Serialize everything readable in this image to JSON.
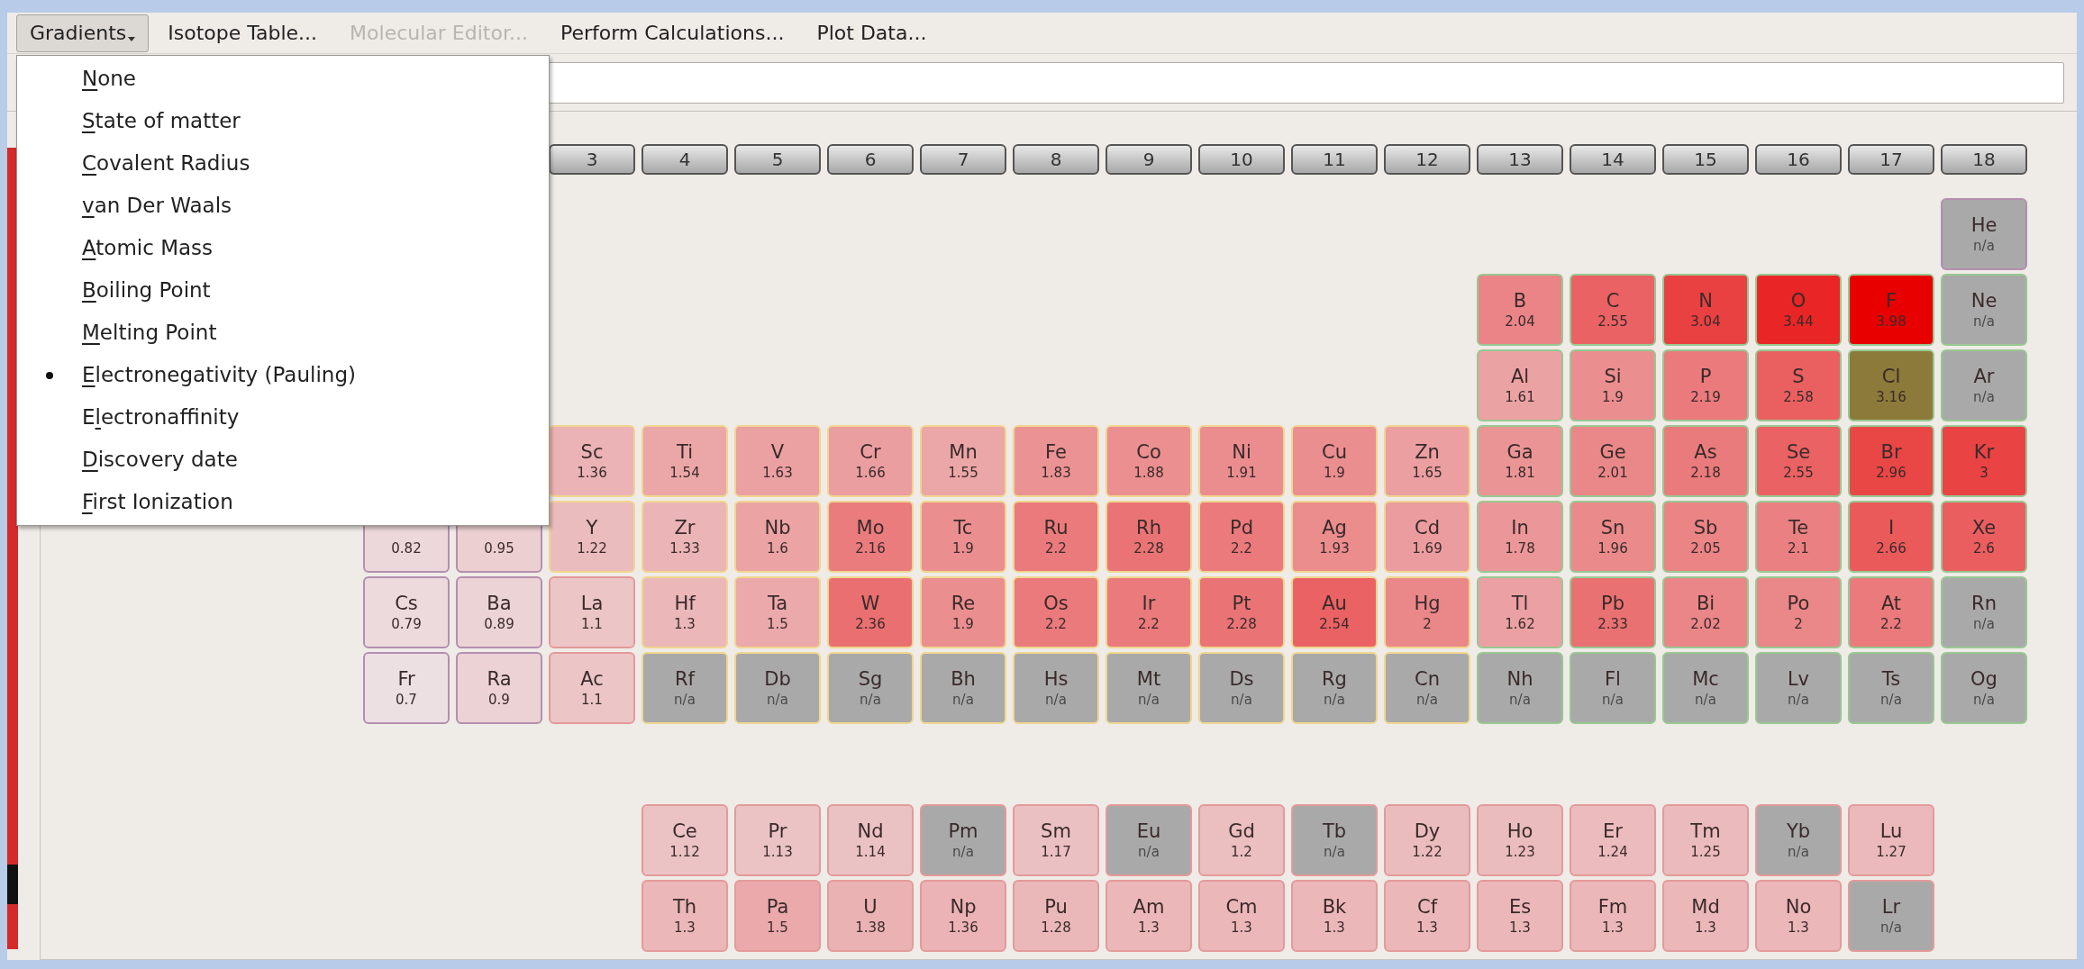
{
  "menubar": [
    {
      "label": "Gradients",
      "open": true,
      "disabled": false
    },
    {
      "label": "Isotope Table...",
      "open": false,
      "disabled": false
    },
    {
      "label": "Molecular Editor...",
      "open": false,
      "disabled": true
    },
    {
      "label": "Perform Calculations...",
      "open": false,
      "disabled": false
    },
    {
      "label": "Plot Data...",
      "open": false,
      "disabled": false
    }
  ],
  "gradients_menu": [
    {
      "key": "N",
      "post": "one",
      "selected": false
    },
    {
      "key": "S",
      "post": "tate of matter",
      "selected": false
    },
    {
      "key": "C",
      "post": "ovalent Radius",
      "selected": false
    },
    {
      "key": "v",
      "post": "an Der Waals",
      "selected": false
    },
    {
      "key": "A",
      "post": "tomic Mass",
      "selected": false
    },
    {
      "key": "B",
      "post": "oiling Point",
      "selected": false
    },
    {
      "key": "M",
      "post": "elting Point",
      "selected": false
    },
    {
      "key": "E",
      "post": "lectronegativity (Pauling)",
      "selected": true
    },
    {
      "pre": "E",
      "key": "l",
      "post": "ectronaffinity",
      "selected": false
    },
    {
      "key": "D",
      "post": "iscovery date",
      "selected": false
    },
    {
      "key": "F",
      "post": "irst Ionization",
      "selected": false
    }
  ],
  "group_headers": [
    "3",
    "4",
    "5",
    "6",
    "7",
    "8",
    "9",
    "10",
    "11",
    "12",
    "13",
    "14",
    "15",
    "16",
    "17",
    "18"
  ],
  "periodic_table": {
    "periods": [
      {
        "cells": [
          {
            "symbol": "He",
            "value": "n/a",
            "kind": "s"
          }
        ]
      },
      {
        "cells": [
          {
            "symbol": "B",
            "value": "2.04",
            "kind": "p"
          },
          {
            "symbol": "C",
            "value": "2.55",
            "kind": "p"
          },
          {
            "symbol": "N",
            "value": "3.04",
            "kind": "p"
          },
          {
            "symbol": "O",
            "value": "3.44",
            "kind": "p"
          },
          {
            "symbol": "F",
            "value": "3.98",
            "kind": "p"
          },
          {
            "symbol": "Ne",
            "value": "n/a",
            "kind": "p"
          }
        ]
      },
      {
        "cells": [
          {
            "symbol": "Al",
            "value": "1.61",
            "kind": "p"
          },
          {
            "symbol": "Si",
            "value": "1.9",
            "kind": "p"
          },
          {
            "symbol": "P",
            "value": "2.19",
            "kind": "p"
          },
          {
            "symbol": "S",
            "value": "2.58",
            "kind": "p"
          },
          {
            "symbol": "Cl",
            "value": "3.16",
            "kind": "p",
            "color": "#8c7a3a"
          },
          {
            "symbol": "Ar",
            "value": "n/a",
            "kind": "p"
          }
        ]
      },
      {
        "cells": [
          {
            "symbol": "Sc",
            "value": "1.36",
            "kind": "d"
          },
          {
            "symbol": "Ti",
            "value": "1.54",
            "kind": "d"
          },
          {
            "symbol": "V",
            "value": "1.63",
            "kind": "d"
          },
          {
            "symbol": "Cr",
            "value": "1.66",
            "kind": "d"
          },
          {
            "symbol": "Mn",
            "value": "1.55",
            "kind": "d"
          },
          {
            "symbol": "Fe",
            "value": "1.83",
            "kind": "d"
          },
          {
            "symbol": "Co",
            "value": "1.88",
            "kind": "d"
          },
          {
            "symbol": "Ni",
            "value": "1.91",
            "kind": "d"
          },
          {
            "symbol": "Cu",
            "value": "1.9",
            "kind": "d"
          },
          {
            "symbol": "Zn",
            "value": "1.65",
            "kind": "d"
          },
          {
            "symbol": "Ga",
            "value": "1.81",
            "kind": "p"
          },
          {
            "symbol": "Ge",
            "value": "2.01",
            "kind": "p"
          },
          {
            "symbol": "As",
            "value": "2.18",
            "kind": "p"
          },
          {
            "symbol": "Se",
            "value": "2.55",
            "kind": "p"
          },
          {
            "symbol": "Br",
            "value": "2.96",
            "kind": "p"
          },
          {
            "symbol": "Kr",
            "value": "3",
            "kind": "p"
          }
        ]
      },
      {
        "cells": [
          {
            "value": "0.82",
            "kind": "s"
          },
          {
            "value": "0.95",
            "kind": "s"
          },
          {
            "symbol": "Y",
            "value": "1.22",
            "kind": "d"
          },
          {
            "symbol": "Zr",
            "value": "1.33",
            "kind": "d"
          },
          {
            "symbol": "Nb",
            "value": "1.6",
            "kind": "d"
          },
          {
            "symbol": "Mo",
            "value": "2.16",
            "kind": "d"
          },
          {
            "symbol": "Tc",
            "value": "1.9",
            "kind": "d"
          },
          {
            "symbol": "Ru",
            "value": "2.2",
            "kind": "d"
          },
          {
            "symbol": "Rh",
            "value": "2.28",
            "kind": "d"
          },
          {
            "symbol": "Pd",
            "value": "2.2",
            "kind": "d"
          },
          {
            "symbol": "Ag",
            "value": "1.93",
            "kind": "d"
          },
          {
            "symbol": "Cd",
            "value": "1.69",
            "kind": "d"
          },
          {
            "symbol": "In",
            "value": "1.78",
            "kind": "p"
          },
          {
            "symbol": "Sn",
            "value": "1.96",
            "kind": "p"
          },
          {
            "symbol": "Sb",
            "value": "2.05",
            "kind": "p"
          },
          {
            "symbol": "Te",
            "value": "2.1",
            "kind": "p"
          },
          {
            "symbol": "I",
            "value": "2.66",
            "kind": "p"
          },
          {
            "symbol": "Xe",
            "value": "2.6",
            "kind": "p"
          }
        ]
      },
      {
        "cells": [
          {
            "symbol": "Cs",
            "value": "0.79",
            "kind": "s"
          },
          {
            "symbol": "Ba",
            "value": "0.89",
            "kind": "s"
          },
          {
            "symbol": "La",
            "value": "1.1",
            "kind": "f"
          },
          {
            "symbol": "Hf",
            "value": "1.3",
            "kind": "d"
          },
          {
            "symbol": "Ta",
            "value": "1.5",
            "kind": "d"
          },
          {
            "symbol": "W",
            "value": "2.36",
            "kind": "d"
          },
          {
            "symbol": "Re",
            "value": "1.9",
            "kind": "d"
          },
          {
            "symbol": "Os",
            "value": "2.2",
            "kind": "d"
          },
          {
            "symbol": "Ir",
            "value": "2.2",
            "kind": "d"
          },
          {
            "symbol": "Pt",
            "value": "2.28",
            "kind": "d"
          },
          {
            "symbol": "Au",
            "value": "2.54",
            "kind": "d"
          },
          {
            "symbol": "Hg",
            "value": "2",
            "kind": "d"
          },
          {
            "symbol": "Tl",
            "value": "1.62",
            "kind": "p"
          },
          {
            "symbol": "Pb",
            "value": "2.33",
            "kind": "p"
          },
          {
            "symbol": "Bi",
            "value": "2.02",
            "kind": "p"
          },
          {
            "symbol": "Po",
            "value": "2",
            "kind": "p"
          },
          {
            "symbol": "At",
            "value": "2.2",
            "kind": "p"
          },
          {
            "symbol": "Rn",
            "value": "n/a",
            "kind": "p"
          }
        ]
      },
      {
        "cells": [
          {
            "symbol": "Fr",
            "value": "0.7",
            "kind": "s"
          },
          {
            "symbol": "Ra",
            "value": "0.9",
            "kind": "s"
          },
          {
            "symbol": "Ac",
            "value": "1.1",
            "kind": "f"
          },
          {
            "symbol": "Rf",
            "value": "n/a",
            "kind": "d"
          },
          {
            "symbol": "Db",
            "value": "n/a",
            "kind": "d"
          },
          {
            "symbol": "Sg",
            "value": "n/a",
            "kind": "d"
          },
          {
            "symbol": "Bh",
            "value": "n/a",
            "kind": "d"
          },
          {
            "symbol": "Hs",
            "value": "n/a",
            "kind": "d"
          },
          {
            "symbol": "Mt",
            "value": "n/a",
            "kind": "d"
          },
          {
            "symbol": "Ds",
            "value": "n/a",
            "kind": "d"
          },
          {
            "symbol": "Rg",
            "value": "n/a",
            "kind": "d"
          },
          {
            "symbol": "Cn",
            "value": "n/a",
            "kind": "d"
          },
          {
            "symbol": "Nh",
            "value": "n/a",
            "kind": "p"
          },
          {
            "symbol": "Fl",
            "value": "n/a",
            "kind": "p"
          },
          {
            "symbol": "Mc",
            "value": "n/a",
            "kind": "p"
          },
          {
            "symbol": "Lv",
            "value": "n/a",
            "kind": "p"
          },
          {
            "symbol": "Ts",
            "value": "n/a",
            "kind": "p"
          },
          {
            "symbol": "Og",
            "value": "n/a",
            "kind": "p"
          }
        ]
      }
    ]
  },
  "f_block": {
    "rows": [
      {
        "cells": [
          {
            "symbol": "Ce",
            "value": "1.12",
            "kind": "f"
          },
          {
            "symbol": "Pr",
            "value": "1.13",
            "kind": "f"
          },
          {
            "symbol": "Nd",
            "value": "1.14",
            "kind": "f"
          },
          {
            "symbol": "Pm",
            "value": "n/a",
            "kind": "f"
          },
          {
            "symbol": "Sm",
            "value": "1.17",
            "kind": "f"
          },
          {
            "symbol": "Eu",
            "value": "n/a",
            "kind": "f"
          },
          {
            "symbol": "Gd",
            "value": "1.2",
            "kind": "f"
          },
          {
            "symbol": "Tb",
            "value": "n/a",
            "kind": "f"
          },
          {
            "symbol": "Dy",
            "value": "1.22",
            "kind": "f"
          },
          {
            "symbol": "Ho",
            "value": "1.23",
            "kind": "f"
          },
          {
            "symbol": "Er",
            "value": "1.24",
            "kind": "f"
          },
          {
            "symbol": "Tm",
            "value": "1.25",
            "kind": "f"
          },
          {
            "symbol": "Yb",
            "value": "n/a",
            "kind": "f"
          },
          {
            "symbol": "Lu",
            "value": "1.27",
            "kind": "f"
          }
        ]
      },
      {
        "cells": [
          {
            "symbol": "Th",
            "value": "1.3",
            "kind": "f"
          },
          {
            "symbol": "Pa",
            "value": "1.5",
            "kind": "f"
          },
          {
            "symbol": "U",
            "value": "1.38",
            "kind": "f"
          },
          {
            "symbol": "Np",
            "value": "1.36",
            "kind": "f"
          },
          {
            "symbol": "Pu",
            "value": "1.28",
            "kind": "f"
          },
          {
            "symbol": "Am",
            "value": "1.3",
            "kind": "f"
          },
          {
            "symbol": "Cm",
            "value": "1.3",
            "kind": "f"
          },
          {
            "symbol": "Bk",
            "value": "1.3",
            "kind": "f"
          },
          {
            "symbol": "Cf",
            "value": "1.3",
            "kind": "f"
          },
          {
            "symbol": "Es",
            "value": "1.3",
            "kind": "f"
          },
          {
            "symbol": "Fm",
            "value": "1.3",
            "kind": "f"
          },
          {
            "symbol": "Md",
            "value": "1.3",
            "kind": "f"
          },
          {
            "symbol": "No",
            "value": "1.3",
            "kind": "f"
          },
          {
            "symbol": "Lr",
            "value": "n/a",
            "kind": "f"
          }
        ]
      }
    ]
  }
}
